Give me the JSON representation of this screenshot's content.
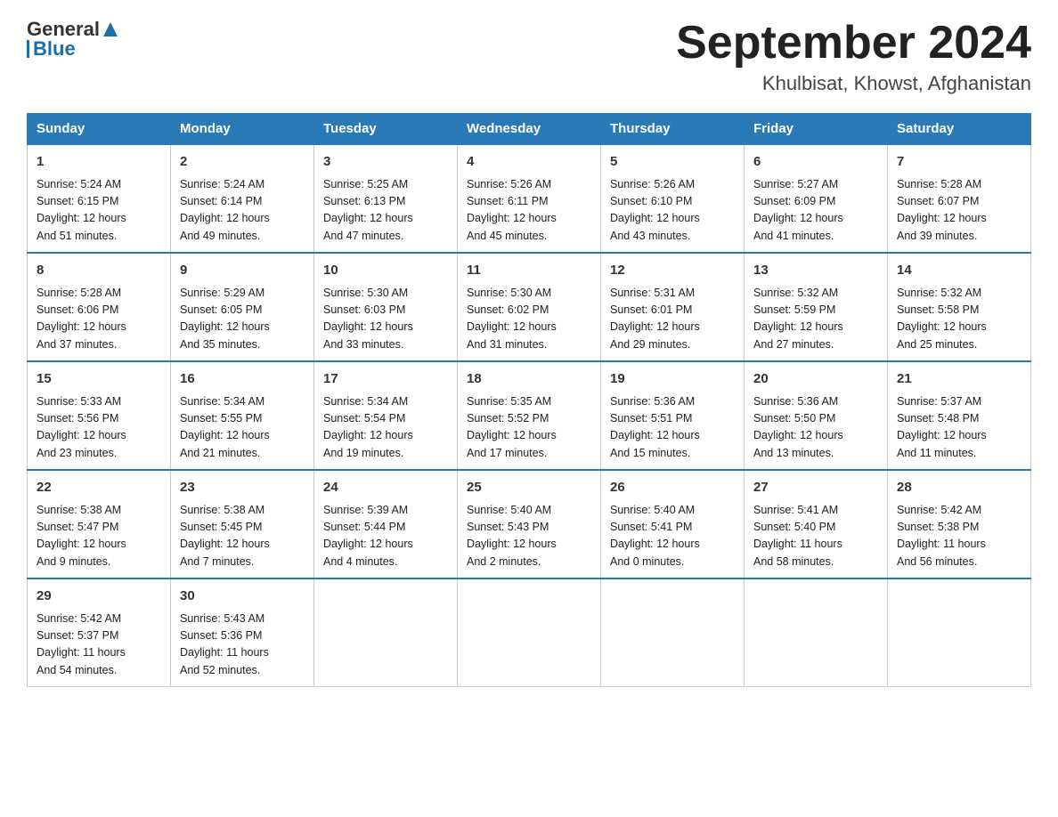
{
  "header": {
    "logo_general": "General",
    "logo_blue": "Blue",
    "title": "September 2024",
    "subtitle": "Khulbisat, Khowst, Afghanistan"
  },
  "columns": [
    "Sunday",
    "Monday",
    "Tuesday",
    "Wednesday",
    "Thursday",
    "Friday",
    "Saturday"
  ],
  "weeks": [
    [
      {
        "day": "1",
        "sunrise": "5:24 AM",
        "sunset": "6:15 PM",
        "daylight": "12 hours and 51 minutes."
      },
      {
        "day": "2",
        "sunrise": "5:24 AM",
        "sunset": "6:14 PM",
        "daylight": "12 hours and 49 minutes."
      },
      {
        "day": "3",
        "sunrise": "5:25 AM",
        "sunset": "6:13 PM",
        "daylight": "12 hours and 47 minutes."
      },
      {
        "day": "4",
        "sunrise": "5:26 AM",
        "sunset": "6:11 PM",
        "daylight": "12 hours and 45 minutes."
      },
      {
        "day": "5",
        "sunrise": "5:26 AM",
        "sunset": "6:10 PM",
        "daylight": "12 hours and 43 minutes."
      },
      {
        "day": "6",
        "sunrise": "5:27 AM",
        "sunset": "6:09 PM",
        "daylight": "12 hours and 41 minutes."
      },
      {
        "day": "7",
        "sunrise": "5:28 AM",
        "sunset": "6:07 PM",
        "daylight": "12 hours and 39 minutes."
      }
    ],
    [
      {
        "day": "8",
        "sunrise": "5:28 AM",
        "sunset": "6:06 PM",
        "daylight": "12 hours and 37 minutes."
      },
      {
        "day": "9",
        "sunrise": "5:29 AM",
        "sunset": "6:05 PM",
        "daylight": "12 hours and 35 minutes."
      },
      {
        "day": "10",
        "sunrise": "5:30 AM",
        "sunset": "6:03 PM",
        "daylight": "12 hours and 33 minutes."
      },
      {
        "day": "11",
        "sunrise": "5:30 AM",
        "sunset": "6:02 PM",
        "daylight": "12 hours and 31 minutes."
      },
      {
        "day": "12",
        "sunrise": "5:31 AM",
        "sunset": "6:01 PM",
        "daylight": "12 hours and 29 minutes."
      },
      {
        "day": "13",
        "sunrise": "5:32 AM",
        "sunset": "5:59 PM",
        "daylight": "12 hours and 27 minutes."
      },
      {
        "day": "14",
        "sunrise": "5:32 AM",
        "sunset": "5:58 PM",
        "daylight": "12 hours and 25 minutes."
      }
    ],
    [
      {
        "day": "15",
        "sunrise": "5:33 AM",
        "sunset": "5:56 PM",
        "daylight": "12 hours and 23 minutes."
      },
      {
        "day": "16",
        "sunrise": "5:34 AM",
        "sunset": "5:55 PM",
        "daylight": "12 hours and 21 minutes."
      },
      {
        "day": "17",
        "sunrise": "5:34 AM",
        "sunset": "5:54 PM",
        "daylight": "12 hours and 19 minutes."
      },
      {
        "day": "18",
        "sunrise": "5:35 AM",
        "sunset": "5:52 PM",
        "daylight": "12 hours and 17 minutes."
      },
      {
        "day": "19",
        "sunrise": "5:36 AM",
        "sunset": "5:51 PM",
        "daylight": "12 hours and 15 minutes."
      },
      {
        "day": "20",
        "sunrise": "5:36 AM",
        "sunset": "5:50 PM",
        "daylight": "12 hours and 13 minutes."
      },
      {
        "day": "21",
        "sunrise": "5:37 AM",
        "sunset": "5:48 PM",
        "daylight": "12 hours and 11 minutes."
      }
    ],
    [
      {
        "day": "22",
        "sunrise": "5:38 AM",
        "sunset": "5:47 PM",
        "daylight": "12 hours and 9 minutes."
      },
      {
        "day": "23",
        "sunrise": "5:38 AM",
        "sunset": "5:45 PM",
        "daylight": "12 hours and 7 minutes."
      },
      {
        "day": "24",
        "sunrise": "5:39 AM",
        "sunset": "5:44 PM",
        "daylight": "12 hours and 4 minutes."
      },
      {
        "day": "25",
        "sunrise": "5:40 AM",
        "sunset": "5:43 PM",
        "daylight": "12 hours and 2 minutes."
      },
      {
        "day": "26",
        "sunrise": "5:40 AM",
        "sunset": "5:41 PM",
        "daylight": "12 hours and 0 minutes."
      },
      {
        "day": "27",
        "sunrise": "5:41 AM",
        "sunset": "5:40 PM",
        "daylight": "11 hours and 58 minutes."
      },
      {
        "day": "28",
        "sunrise": "5:42 AM",
        "sunset": "5:38 PM",
        "daylight": "11 hours and 56 minutes."
      }
    ],
    [
      {
        "day": "29",
        "sunrise": "5:42 AM",
        "sunset": "5:37 PM",
        "daylight": "11 hours and 54 minutes."
      },
      {
        "day": "30",
        "sunrise": "5:43 AM",
        "sunset": "5:36 PM",
        "daylight": "11 hours and 52 minutes."
      },
      null,
      null,
      null,
      null,
      null
    ]
  ],
  "labels": {
    "sunrise": "Sunrise:",
    "sunset": "Sunset:",
    "daylight": "Daylight:"
  }
}
